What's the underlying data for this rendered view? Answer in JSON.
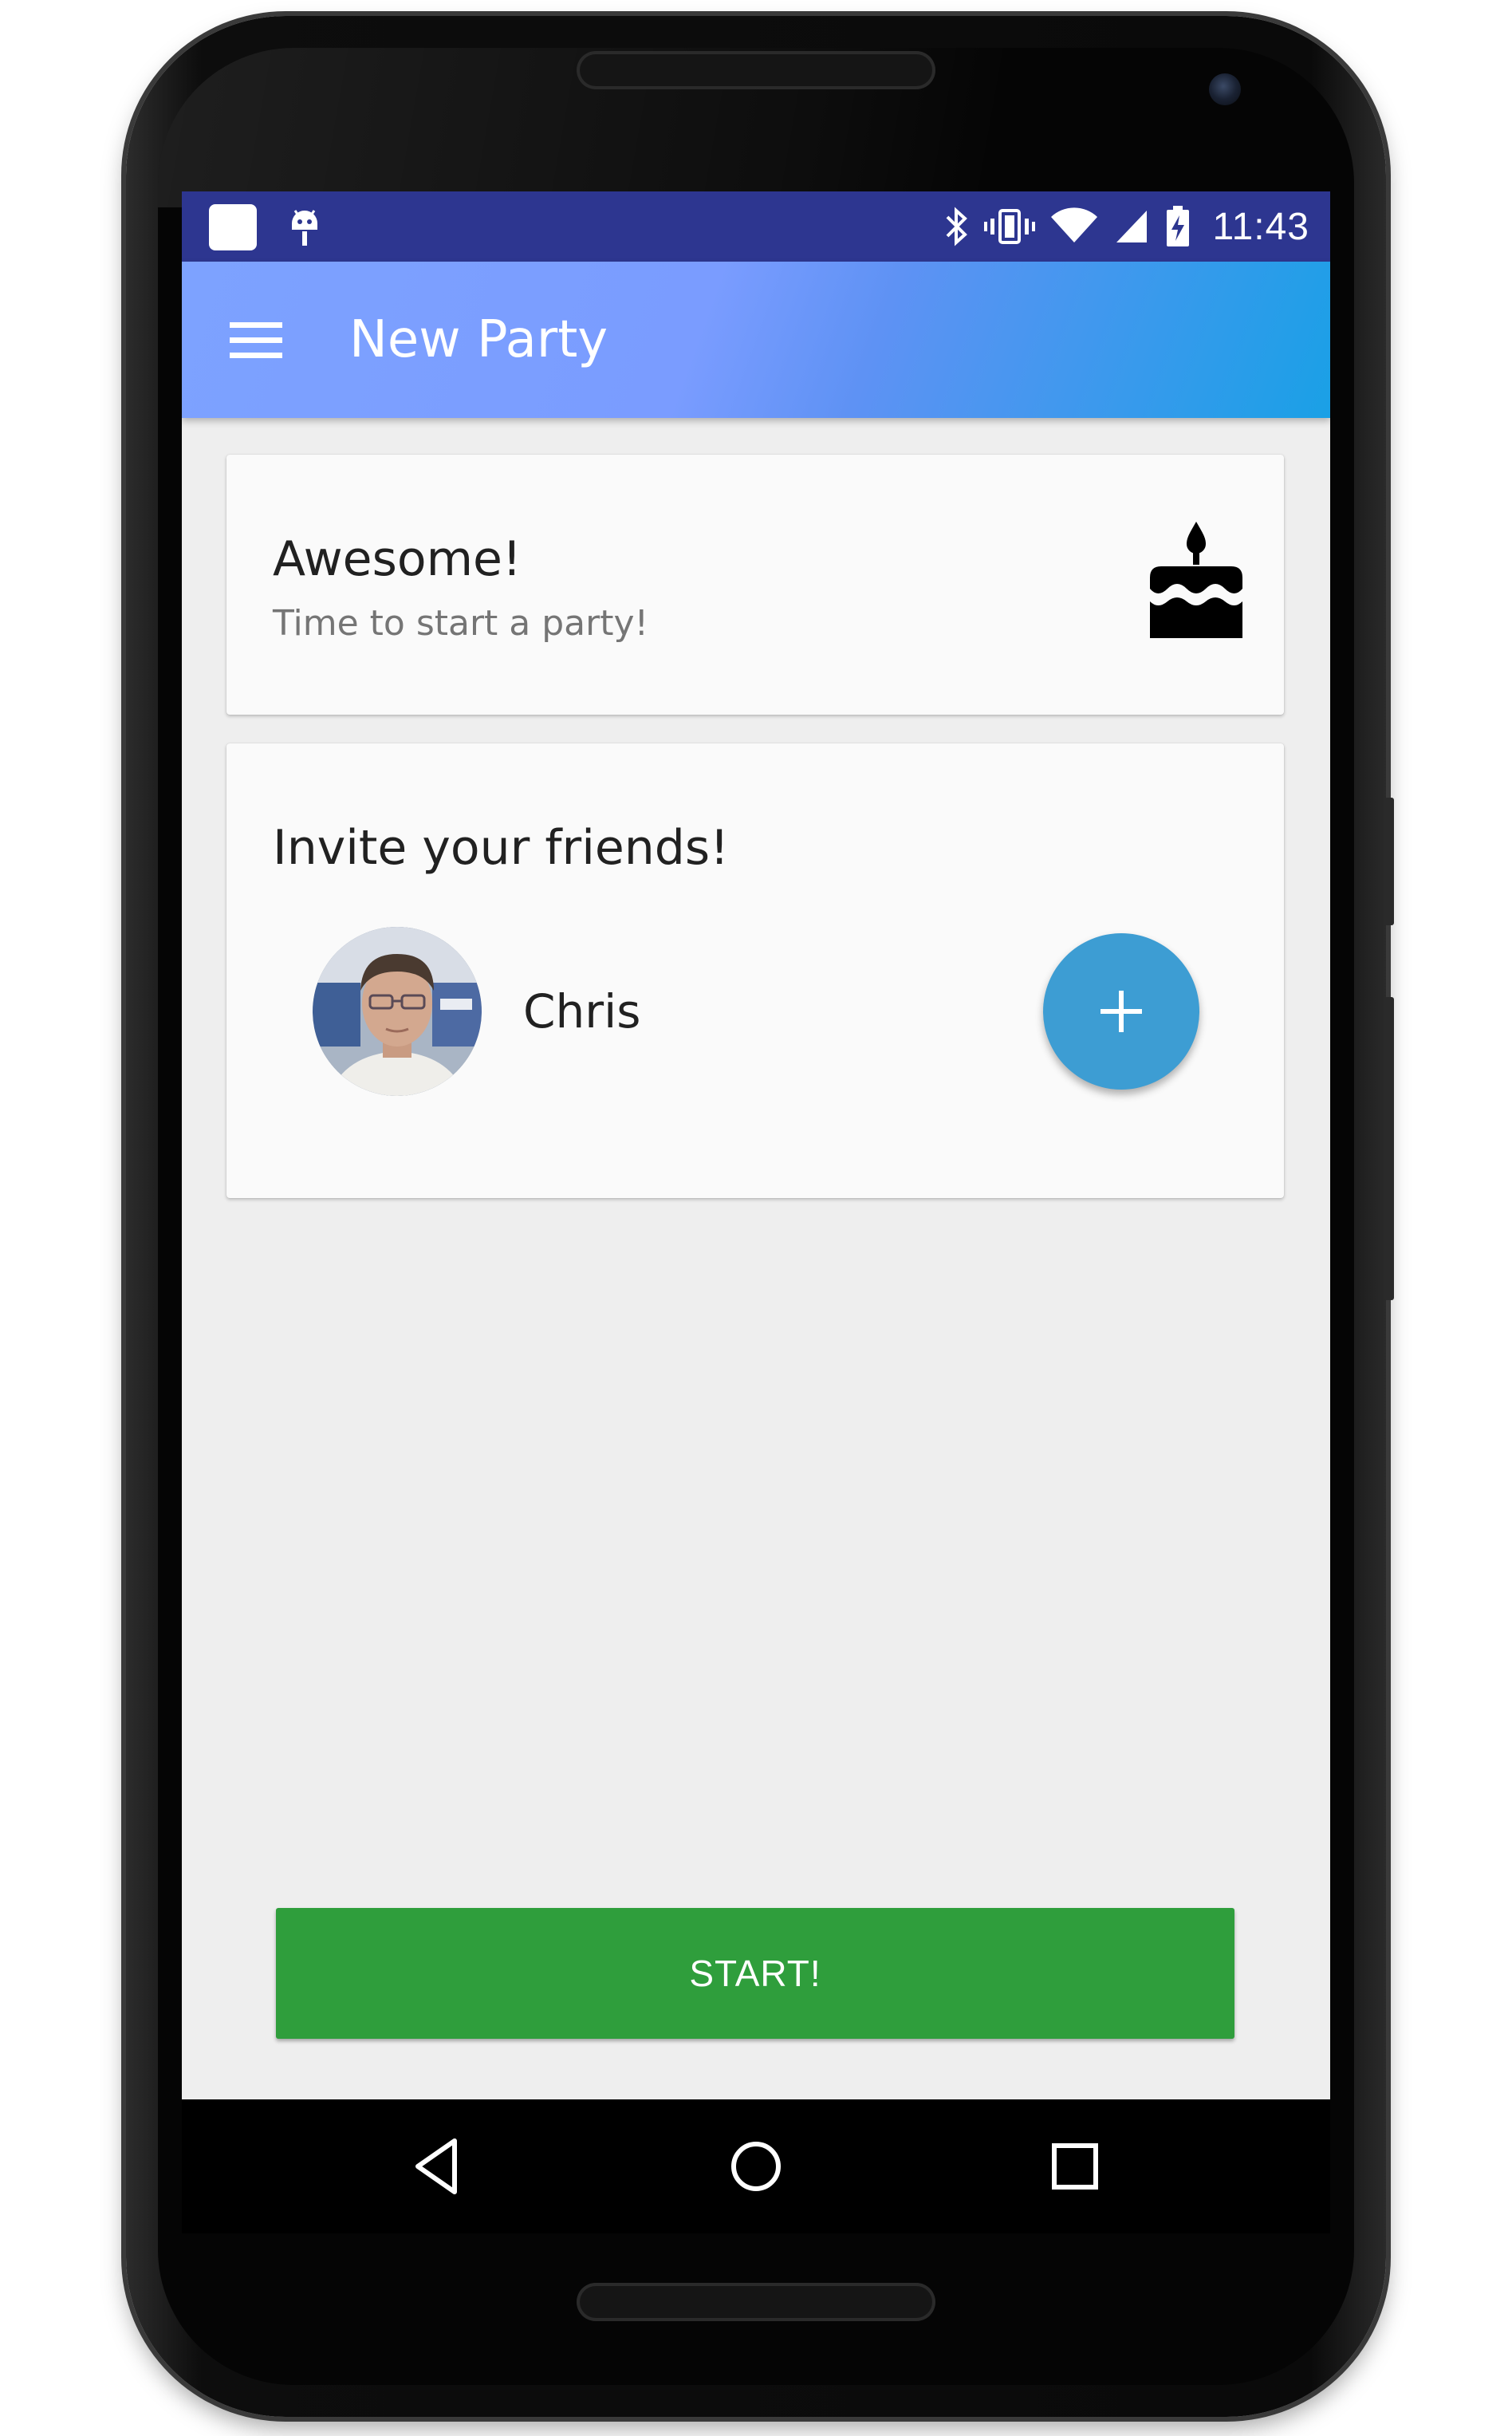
{
  "status_bar": {
    "time": "11:43",
    "icons": [
      "notification-square-icon",
      "android-debug-icon",
      "bluetooth-icon",
      "vibrate-icon",
      "wifi-icon",
      "signal-icon",
      "battery-charging-icon"
    ],
    "background": "#2d3690"
  },
  "app_bar": {
    "menu_icon": "hamburger-menu-icon",
    "title": "New Party",
    "gradient": [
      "#7da2ff",
      "#1aa0e6"
    ]
  },
  "welcome_card": {
    "title": "Awesome!",
    "subtitle": "Time to start a party!",
    "icon": "cake-icon"
  },
  "invite_card": {
    "title": "Invite your friends!",
    "friends": [
      {
        "name": "Chris",
        "avatar": "avatar-photo"
      }
    ],
    "add_button_icon": "plus-icon",
    "add_button_color": "#3d9dd3"
  },
  "start_button": {
    "label": "START!",
    "color": "#2f9e3c"
  },
  "nav_bar": {
    "buttons": [
      "back-icon",
      "home-icon",
      "recents-icon"
    ]
  }
}
